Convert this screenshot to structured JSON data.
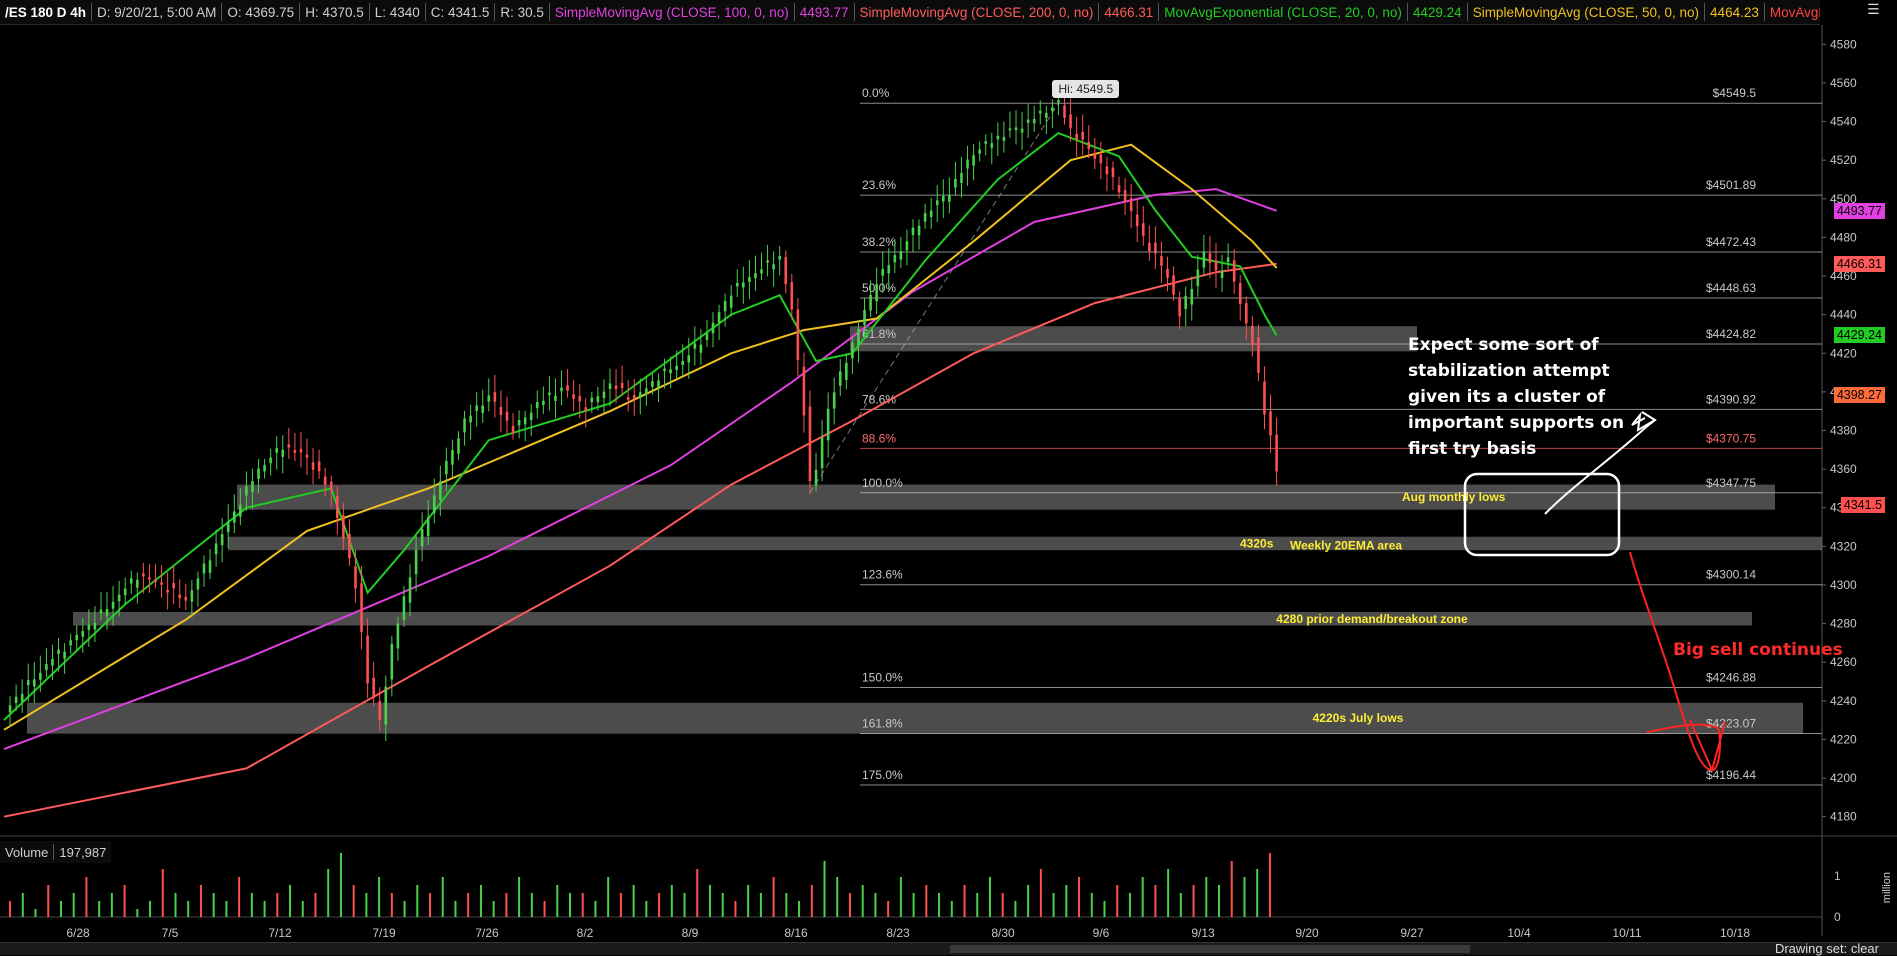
{
  "header": {
    "symbol": "/ES 180 D 4h",
    "ohlc": "D: 9/20/21, 5:00 AM | O: 4369.75 | H: 4370.5 | L: 4340 | C: 4341.5 | R: 30.5",
    "date": "D: 9/20/21, 5:00 AM",
    "open": "O: 4369.75",
    "high": "H: 4370.5",
    "low": "L: 4340",
    "close": "C: 4341.5",
    "range": "R: 30.5",
    "studies": [
      {
        "label": "SimpleMovingAvg (CLOSE, 100, 0, no)",
        "value": "4493.77",
        "color": "#e040e0"
      },
      {
        "label": "SimpleMovingAvg (CLOSE, 200, 0, no)",
        "value": "4466.31",
        "color": "#ff5a5a"
      },
      {
        "label": "MovAvgExponential (CLOSE, 20, 0, no)",
        "value": "4429.24",
        "color": "#22cc22"
      },
      {
        "label": "SimpleMovingAvg (CLOSE, 50, 0, no)",
        "value": "4464.23",
        "color": "#f0c020"
      },
      {
        "label": "MovAvgExponential (CLOSE,",
        "value": "",
        "color": "#ff4444"
      }
    ]
  },
  "volume_header": {
    "label": "Volume",
    "value": "197,987"
  },
  "hi_label": "Hi: 4549.5",
  "annotation_note": "Expect some sort of\nstabilization attempt\ngiven its a cluster of\nimportant supports on\nfirst try basis",
  "annotation_bigsell": "Big sell continues",
  "status_text": "Drawing set: clear",
  "volume_axis": {
    "ticks": [
      "1",
      "0"
    ],
    "unit": "million"
  },
  "chart_data": {
    "type": "line",
    "title": "/ES 180 D 4h",
    "ylim": [
      4170,
      4590
    ],
    "y_ticks": [
      4180,
      4200,
      4220,
      4240,
      4260,
      4280,
      4300,
      4320,
      4340,
      4360,
      4380,
      4400,
      4420,
      4440,
      4460,
      4480,
      4500,
      4520,
      4540,
      4560,
      4580
    ],
    "x_ticks": [
      "6/28",
      "7/5",
      "7/12",
      "7/19",
      "7/26",
      "8/2",
      "8/9",
      "8/16",
      "8/23",
      "8/30",
      "9/6",
      "9/13",
      "9/20",
      "9/27",
      "10/4",
      "10/11",
      "10/18"
    ],
    "price_badges": [
      {
        "value": "4493.77",
        "color": "#e040e0"
      },
      {
        "value": "4466.31",
        "color": "#ff5a5a"
      },
      {
        "value": "4429.24",
        "color": "#22cc22"
      },
      {
        "value": "4398.27",
        "color": "#ff6a3a"
      },
      {
        "value": "4341.5",
        "color": "#ff5050"
      }
    ],
    "fib_levels": [
      {
        "pct": "0.0%",
        "price": "$4549.5",
        "value": 4549.5
      },
      {
        "pct": "23.6%",
        "price": "$4501.89",
        "value": 4501.89
      },
      {
        "pct": "38.2%",
        "price": "$4472.43",
        "value": 4472.43
      },
      {
        "pct": "50.0%",
        "price": "$4448.63",
        "value": 4448.63
      },
      {
        "pct": "61.8%",
        "price": "$4424.82",
        "value": 4424.82
      },
      {
        "pct": "78.6%",
        "price": "$4390.92",
        "value": 4390.92
      },
      {
        "pct": "88.6%",
        "price": "$4370.75",
        "value": 4370.75
      },
      {
        "pct": "100.0%",
        "price": "$4347.75",
        "value": 4347.75
      },
      {
        "pct": "123.6%",
        "price": "$4300.14",
        "value": 4300.14
      },
      {
        "pct": "150.0%",
        "price": "$4246.88",
        "value": 4246.88
      },
      {
        "pct": "161.8%",
        "price": "$4223.07",
        "value": 4223.07
      },
      {
        "pct": "175.0%",
        "price": "$4196.44",
        "value": 4196.44
      }
    ],
    "zones": [
      {
        "low": 4421,
        "high": 4434,
        "label": ""
      },
      {
        "low": 4339,
        "high": 4352,
        "label": "Aug monthly lows"
      },
      {
        "low": 4318,
        "high": 4325,
        "label": "4320s",
        "label2": "Weekly 20EMA area"
      },
      {
        "low": 4279,
        "high": 4286,
        "label": "4280 prior demand/breakout zone"
      },
      {
        "low": 4223,
        "high": 4239,
        "label": "4220s July lows"
      }
    ],
    "price_path": [
      [
        0,
        4235
      ],
      [
        4,
        4262
      ],
      [
        8,
        4285
      ],
      [
        11,
        4305
      ],
      [
        13,
        4300
      ],
      [
        15,
        4292
      ],
      [
        17,
        4315
      ],
      [
        19,
        4338
      ],
      [
        21,
        4360
      ],
      [
        23,
        4372
      ],
      [
        25,
        4366
      ],
      [
        27,
        4348
      ],
      [
        29,
        4300
      ],
      [
        30,
        4250
      ],
      [
        31,
        4230
      ],
      [
        32,
        4268
      ],
      [
        34,
        4318
      ],
      [
        36,
        4355
      ],
      [
        38,
        4385
      ],
      [
        40,
        4398
      ],
      [
        42,
        4380
      ],
      [
        44,
        4394
      ],
      [
        46,
        4402
      ],
      [
        48,
        4392
      ],
      [
        50,
        4404
      ],
      [
        52,
        4396
      ],
      [
        54,
        4408
      ],
      [
        56,
        4416
      ],
      [
        58,
        4430
      ],
      [
        60,
        4452
      ],
      [
        62,
        4462
      ],
      [
        64,
        4470
      ],
      [
        65,
        4442
      ],
      [
        66,
        4390
      ],
      [
        66.5,
        4352
      ],
      [
        67,
        4360
      ],
      [
        68,
        4392
      ],
      [
        70,
        4425
      ],
      [
        72,
        4458
      ],
      [
        74,
        4474
      ],
      [
        76,
        4492
      ],
      [
        78,
        4504
      ],
      [
        80,
        4524
      ],
      [
        82,
        4532
      ],
      [
        84,
        4538
      ],
      [
        86,
        4546
      ],
      [
        87,
        4549.5
      ],
      [
        88,
        4536
      ],
      [
        90,
        4522
      ],
      [
        92,
        4505
      ],
      [
        94,
        4480
      ],
      [
        96,
        4460
      ],
      [
        97,
        4440
      ],
      [
        98,
        4455
      ],
      [
        99,
        4472
      ],
      [
        100,
        4462
      ],
      [
        101,
        4468
      ],
      [
        102,
        4446
      ],
      [
        103,
        4425
      ],
      [
        104,
        4390
      ],
      [
        104.8,
        4370
      ],
      [
        105.3,
        4341.5
      ]
    ],
    "moving_averages": [
      {
        "name": "SMA100",
        "color": "#e040e0",
        "points": [
          [
            0,
            4215
          ],
          [
            20,
            4262
          ],
          [
            40,
            4315
          ],
          [
            55,
            4362
          ],
          [
            65,
            4405
          ],
          [
            75,
            4452
          ],
          [
            85,
            4488
          ],
          [
            95,
            4502
          ],
          [
            100,
            4505
          ],
          [
            105,
            4493.77
          ]
        ]
      },
      {
        "name": "SMA200",
        "color": "#ff5a5a",
        "points": [
          [
            0,
            4180
          ],
          [
            20,
            4205
          ],
          [
            35,
            4258
          ],
          [
            50,
            4310
          ],
          [
            60,
            4352
          ],
          [
            70,
            4385
          ],
          [
            80,
            4420
          ],
          [
            90,
            4446
          ],
          [
            100,
            4462
          ],
          [
            105,
            4466.31
          ]
        ]
      },
      {
        "name": "SMA50",
        "color": "#f0c020",
        "points": [
          [
            0,
            4225
          ],
          [
            15,
            4282
          ],
          [
            25,
            4328
          ],
          [
            35,
            4350
          ],
          [
            50,
            4390
          ],
          [
            60,
            4420
          ],
          [
            66,
            4432
          ],
          [
            72,
            4438
          ],
          [
            80,
            4478
          ],
          [
            88,
            4520
          ],
          [
            93,
            4528
          ],
          [
            98,
            4505
          ],
          [
            103,
            4478
          ],
          [
            105,
            4464.23
          ]
        ]
      },
      {
        "name": "EMA20",
        "color": "#22cc22",
        "points": [
          [
            0,
            4230
          ],
          [
            10,
            4290
          ],
          [
            20,
            4340
          ],
          [
            27,
            4350
          ],
          [
            30,
            4296
          ],
          [
            33,
            4318
          ],
          [
            40,
            4375
          ],
          [
            50,
            4394
          ],
          [
            60,
            4440
          ],
          [
            64,
            4450
          ],
          [
            67,
            4416
          ],
          [
            70,
            4420
          ],
          [
            76,
            4468
          ],
          [
            82,
            4510
          ],
          [
            87,
            4534
          ],
          [
            92,
            4522
          ],
          [
            95,
            4494
          ],
          [
            98,
            4470
          ],
          [
            102,
            4465
          ],
          [
            104,
            4440
          ],
          [
            105,
            4429.24
          ]
        ]
      }
    ],
    "volume": [
      2,
      3,
      1,
      4,
      2,
      3,
      5,
      2,
      3,
      4,
      1,
      2,
      6,
      3,
      2,
      4,
      3,
      2,
      5,
      3,
      2,
      3,
      4,
      2,
      3,
      6,
      8,
      4,
      3,
      5,
      3,
      2,
      4,
      3,
      5,
      2,
      3,
      4,
      2,
      3,
      5,
      3,
      2,
      4,
      3,
      3,
      2,
      5,
      3,
      4,
      2,
      3,
      4,
      3,
      6,
      4,
      3,
      2,
      4,
      3,
      5,
      3,
      2,
      4,
      7,
      5,
      3,
      4,
      3,
      2,
      5,
      3,
      4,
      3,
      2,
      4,
      3,
      5,
      3,
      2,
      4,
      6,
      3,
      4,
      5,
      3,
      2,
      4,
      3,
      5,
      4,
      6,
      3,
      4,
      5,
      4,
      7,
      5,
      6,
      8
    ],
    "grid": false,
    "legend": "top"
  }
}
